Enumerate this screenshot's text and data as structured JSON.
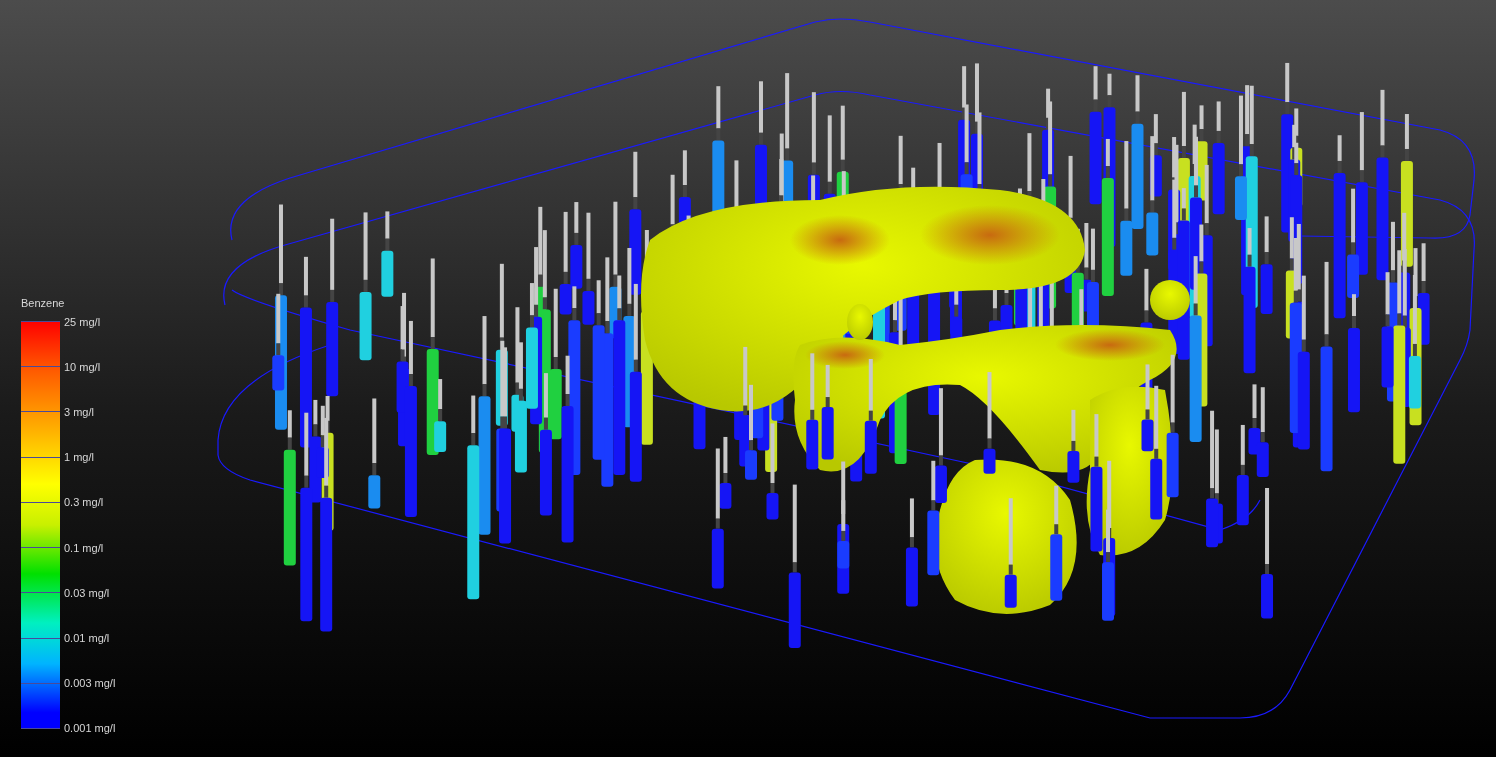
{
  "legend": {
    "title": "Benzene",
    "labels": [
      "25 mg/l",
      "10 mg/l",
      "3 mg/l",
      "1 mg/l",
      "0.3 mg/l",
      "0.1 mg/l",
      "0.03 mg/l",
      "0.01 mg/l",
      "0.003 mg/l",
      "0.001 mg/l"
    ]
  }
}
